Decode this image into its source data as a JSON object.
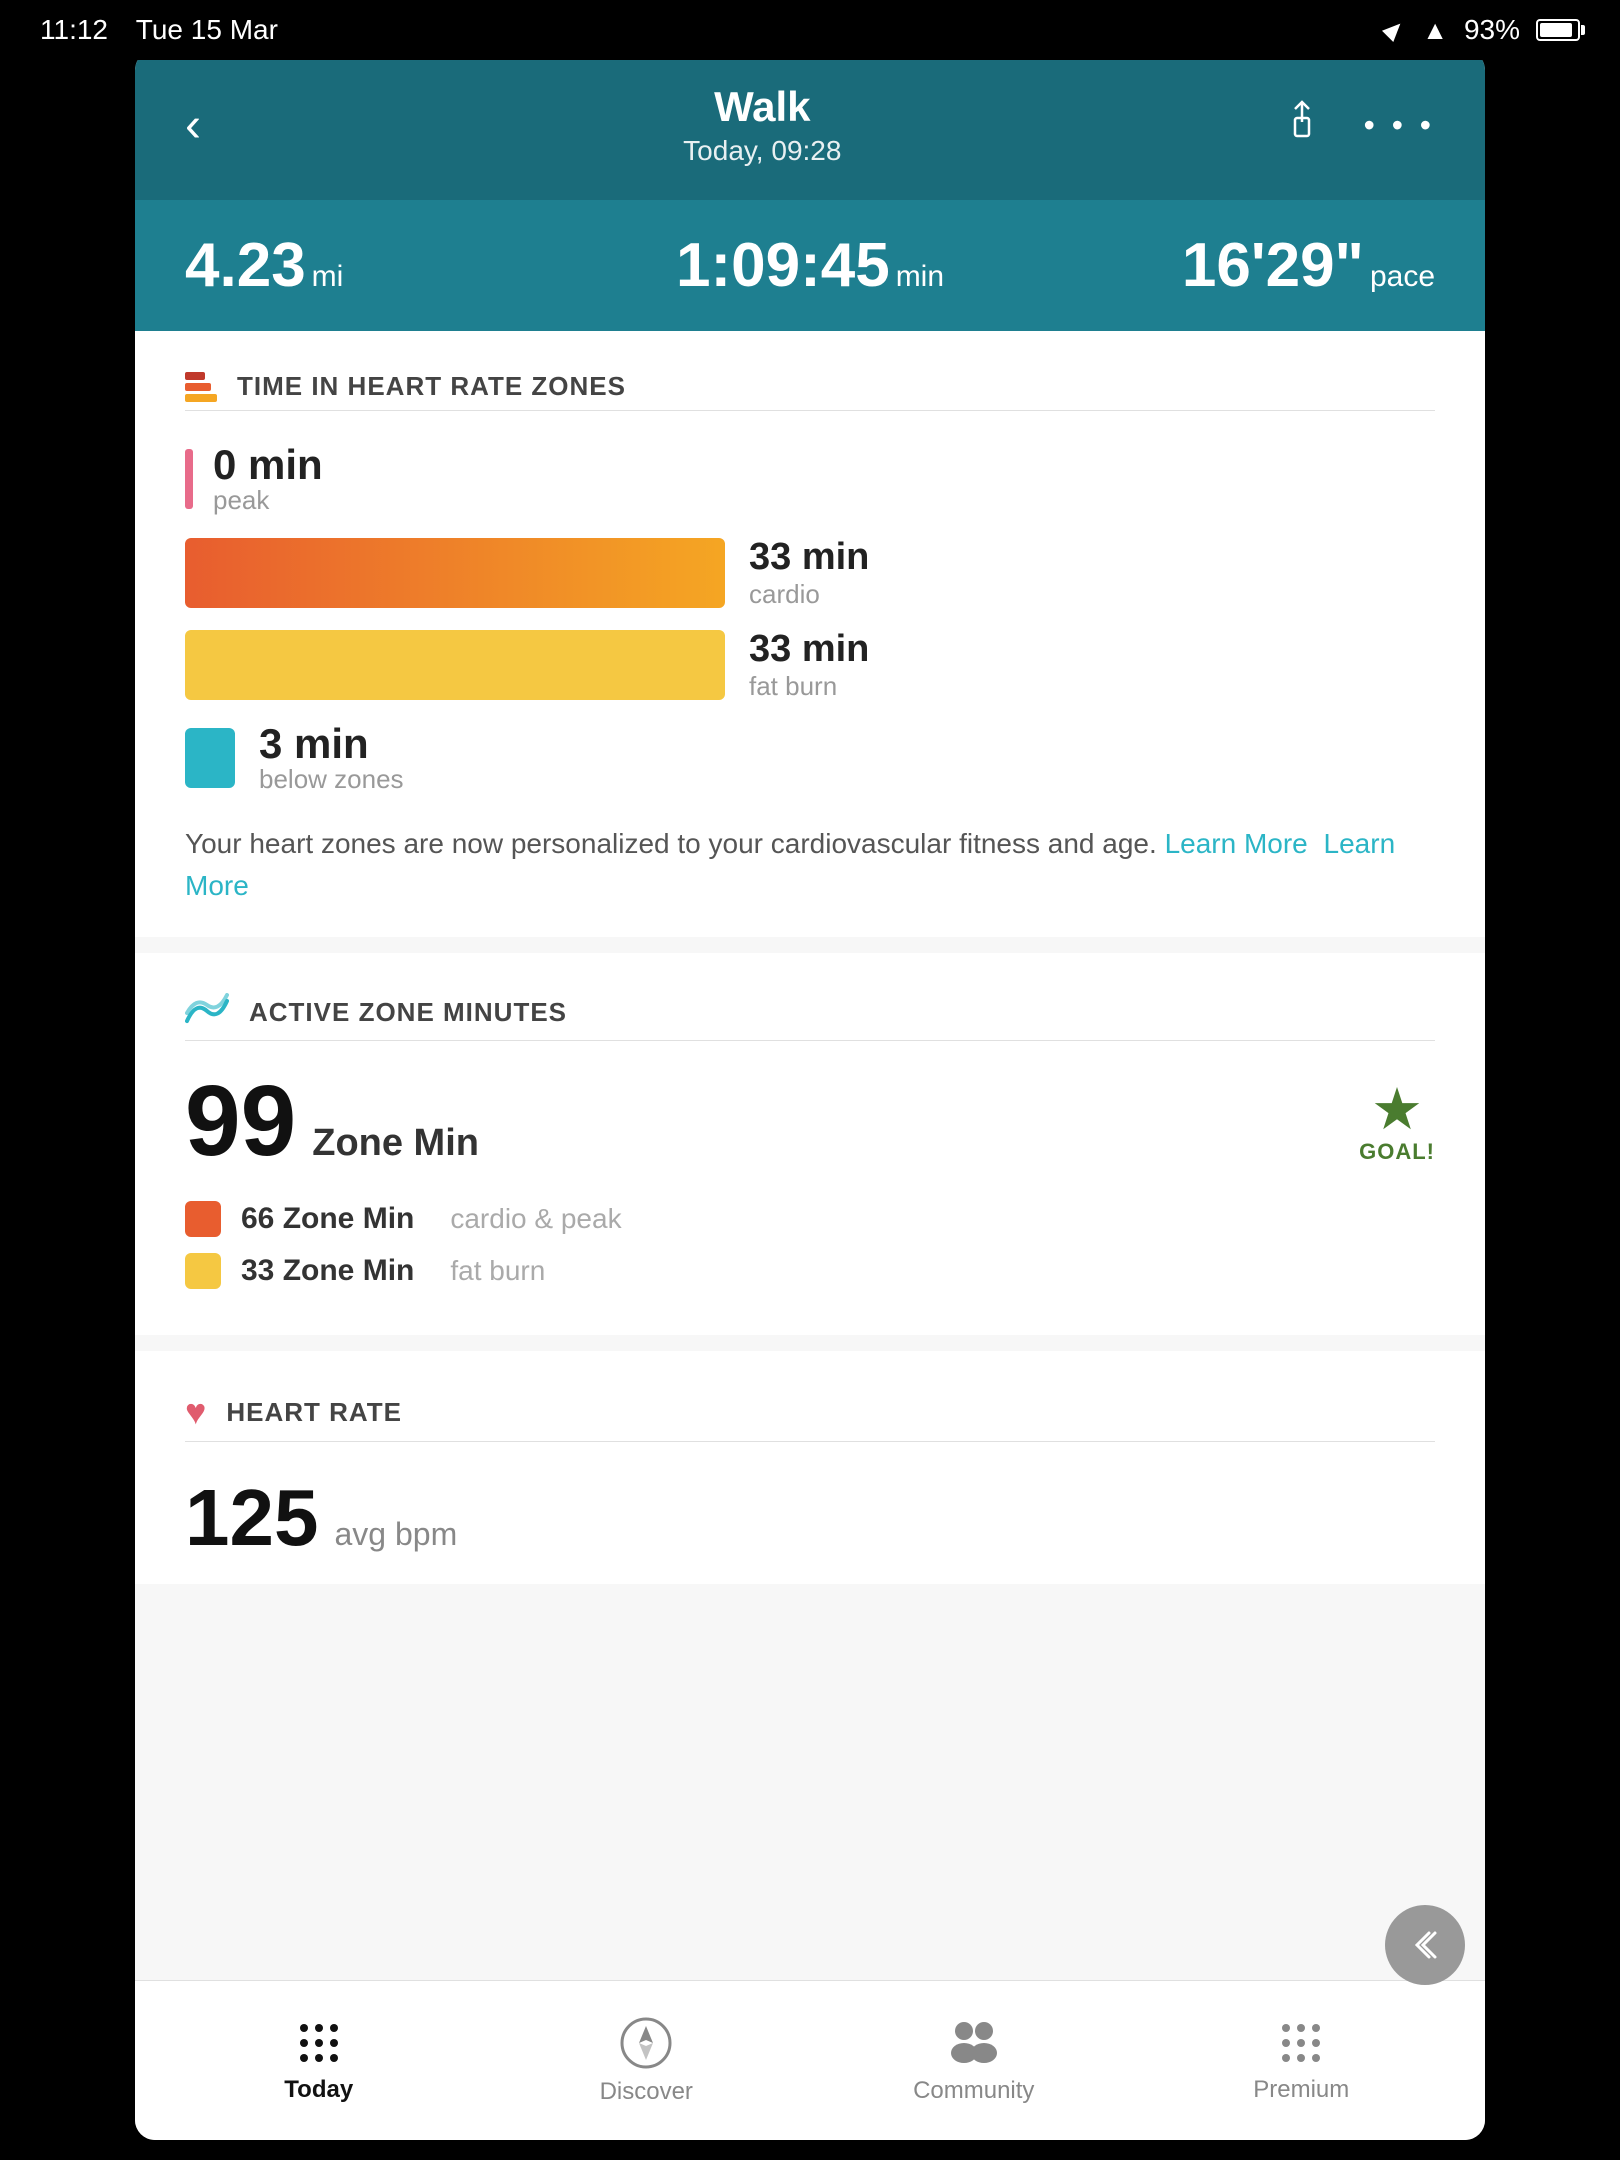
{
  "statusBar": {
    "time": "11:12",
    "date": "Tue 15 Mar",
    "battery": "93%"
  },
  "header": {
    "title": "Walk",
    "subtitle": "Today, 09:28",
    "backLabel": "‹",
    "moreLabel": "• • •"
  },
  "stats": {
    "distance": {
      "value": "4.23",
      "unit": "mi"
    },
    "duration": {
      "value": "1:09:45",
      "unit": "min"
    },
    "pace": {
      "value": "16'29\"",
      "unit": "pace"
    }
  },
  "heartRateZones": {
    "sectionTitle": "TIME IN HEART RATE ZONES",
    "peak": {
      "value": "0 min",
      "label": "peak"
    },
    "cardio": {
      "value": "33 min",
      "label": "cardio"
    },
    "fatBurn": {
      "value": "33 min",
      "label": "fat burn"
    },
    "belowZones": {
      "value": "3 min",
      "label": "below zones"
    },
    "infoText": "Your heart zones are now personalized to your cardiovascular fitness and age.",
    "learnMore": "Learn More"
  },
  "activeZoneMinutes": {
    "sectionTitle": "ACTIVE ZONE MINUTES",
    "total": "99",
    "unit": "Zone Min",
    "goalLabel": "GOAL!",
    "cardioPeak": {
      "value": "66 Zone Min",
      "label": "cardio & peak"
    },
    "fatBurn": {
      "value": "33 Zone Min",
      "label": "fat burn"
    }
  },
  "heartRate": {
    "sectionTitle": "HEART RATE",
    "avgBpm": "125",
    "unit": "avg bpm"
  },
  "bottomNav": {
    "today": "Today",
    "discover": "Discover",
    "community": "Community",
    "premium": "Premium"
  }
}
